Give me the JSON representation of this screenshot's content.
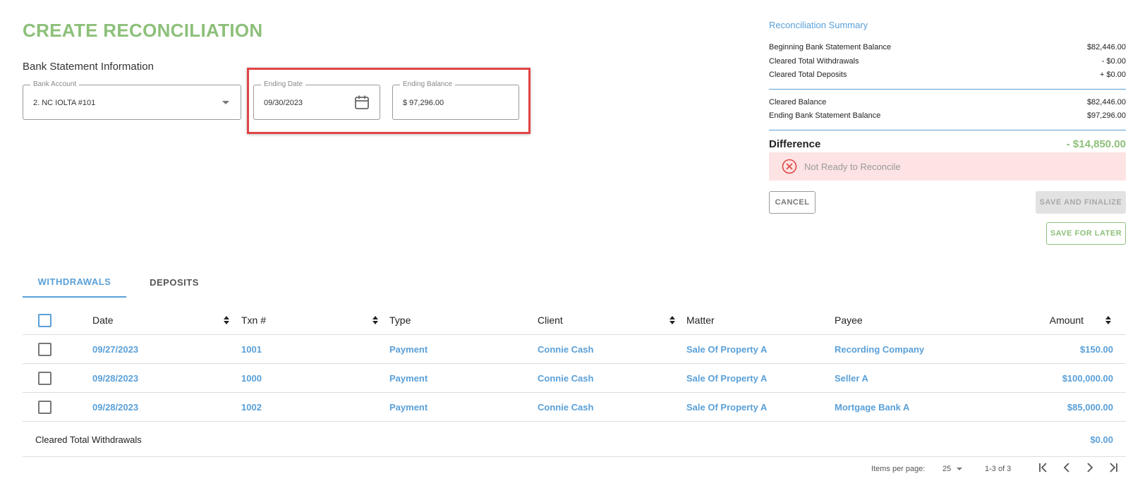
{
  "page_title": "CREATE RECONCILIATION",
  "section_title": "Bank Statement Information",
  "fields": {
    "bank_account": {
      "label": "Bank Account",
      "value": "2. NC IOLTA #101"
    },
    "ending_date": {
      "label": "Ending Date",
      "value": "09/30/2023"
    },
    "ending_balance": {
      "label": "Ending Balance",
      "value": "$ 97,296.00"
    }
  },
  "summary": {
    "title": "Reconciliation Summary",
    "rows": [
      {
        "label": "Beginning Bank Statement Balance",
        "value": "$82,446.00"
      },
      {
        "label": "Cleared Total Withdrawals",
        "value": "- $0.00"
      },
      {
        "label": "Cleared Total Deposits",
        "value": "+ $0.00"
      },
      {
        "label": "Cleared Balance",
        "value": "$82,446.00"
      },
      {
        "label": "Ending Bank Statement Balance",
        "value": "$97,296.00"
      }
    ],
    "difference_label": "Difference",
    "difference_value": "- $14,850.00",
    "status_text": "Not Ready to Reconcile"
  },
  "buttons": {
    "cancel": "CANCEL",
    "save_finalize": "SAVE AND FINALIZE",
    "save_later": "SAVE FOR LATER"
  },
  "tabs": [
    "WITHDRAWALS",
    "DEPOSITS"
  ],
  "table": {
    "columns": [
      "Date",
      "Txn #",
      "Type",
      "Client",
      "Matter",
      "Payee",
      "Amount"
    ],
    "rows": [
      {
        "date": "09/27/2023",
        "txn": "1001",
        "type": "Payment",
        "client": "Connie Cash",
        "matter": "Sale Of Property A",
        "payee": "Recording Company",
        "amount": "$150.00"
      },
      {
        "date": "09/28/2023",
        "txn": "1000",
        "type": "Payment",
        "client": "Connie Cash",
        "matter": "Sale Of Property A",
        "payee": "Seller A",
        "amount": "$100,000.00"
      },
      {
        "date": "09/28/2023",
        "txn": "1002",
        "type": "Payment",
        "client": "Connie Cash",
        "matter": "Sale Of Property A",
        "payee": "Mortgage Bank A",
        "amount": "$85,000.00"
      }
    ],
    "footer_label": "Cleared Total Withdrawals",
    "footer_value": "$0.00"
  },
  "pagination": {
    "items_per_page_label": "Items per page:",
    "items_per_page": "25",
    "range": "1-3 of 3"
  },
  "colors": {
    "accent_blue": "#5aa0d8",
    "accent_green": "#8dc07a",
    "highlight_red": "#e04545",
    "status_bg": "#fde3e3"
  }
}
